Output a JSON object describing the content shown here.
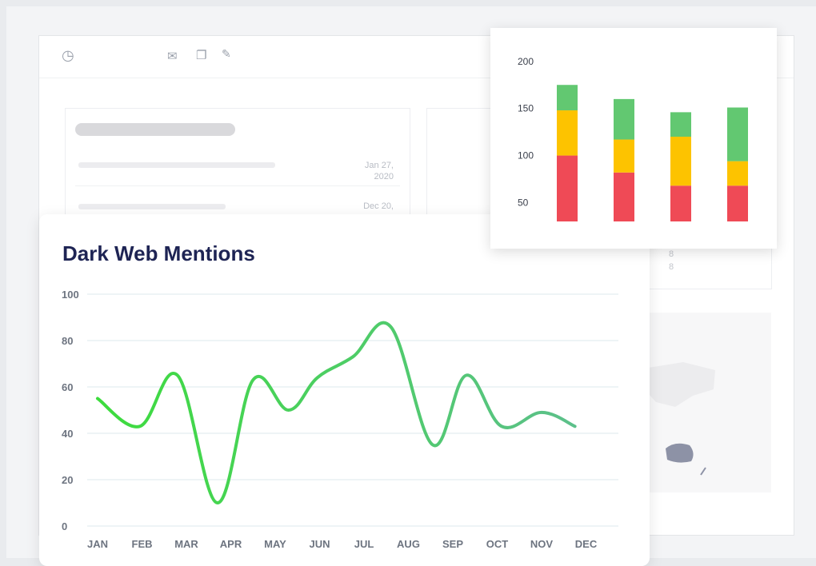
{
  "background_dashboard": {
    "toolbar_icons": [
      "clock-icon",
      "mail-add-icon",
      "copy-icon",
      "edit-icon"
    ],
    "list_dates": [
      "Jan 27,\n2020",
      "Dec 20,"
    ],
    "side_numbers": [
      "8",
      "8"
    ]
  },
  "chart_data": [
    {
      "type": "line",
      "title": "Dark Web Mentions",
      "x": [
        "JAN",
        "FEB",
        "MAR",
        "APR",
        "MAY",
        "JUN",
        "JUL",
        "AUG",
        "SEP",
        "OCT",
        "NOV",
        "DEC"
      ],
      "y_ticks": [
        0,
        20,
        40,
        60,
        80,
        100
      ],
      "ylim": [
        0,
        100
      ],
      "series": [
        {
          "values": [
            55,
            43,
            65,
            10,
            63,
            50,
            64,
            73,
            86,
            35,
            65,
            43,
            49,
            43
          ]
        }
      ],
      "series_x": [
        0,
        0.95,
        1.8,
        2.7,
        3.5,
        4.3,
        4.95,
        5.75,
        6.6,
        7.55,
        8.3,
        9.1,
        10.0,
        10.75
      ],
      "color_start": "#3ddc3d",
      "color_end": "#5cc08a",
      "grid": true
    },
    {
      "type": "bar",
      "stacked": true,
      "categories": [
        "",
        "",
        "",
        ""
      ],
      "y_ticks": [
        50,
        100,
        150,
        200
      ],
      "ylim": [
        30,
        210
      ],
      "series": [
        {
          "color": "#ef4a56",
          "values": [
            100,
            82,
            68,
            68
          ]
        },
        {
          "color": "#fdc300",
          "values": [
            48,
            35,
            52,
            26
          ]
        },
        {
          "color": "#62c871",
          "values": [
            27,
            43,
            26,
            57
          ]
        }
      ]
    }
  ]
}
